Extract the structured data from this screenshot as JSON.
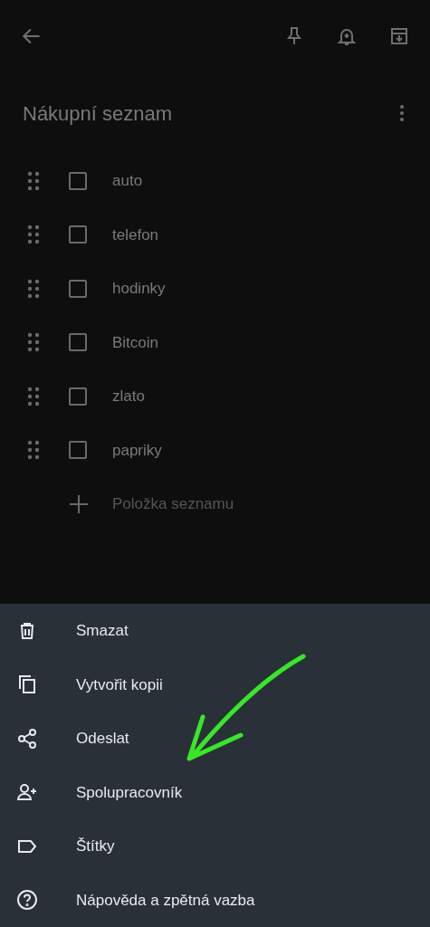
{
  "note": {
    "title": "Nákupní seznam",
    "items": [
      {
        "text": "auto",
        "checked": false
      },
      {
        "text": "telefon",
        "checked": false
      },
      {
        "text": "hodinky",
        "checked": false
      },
      {
        "text": "Bitcoin",
        "checked": false
      },
      {
        "text": "zlato",
        "checked": false
      },
      {
        "text": "papriky",
        "checked": false
      }
    ],
    "add_item": {
      "placeholder": "Položka seznamu"
    }
  },
  "menu": [
    {
      "kind": "delete",
      "label": "Smazat"
    },
    {
      "kind": "copy",
      "label": "Vytvořit kopii"
    },
    {
      "kind": "share",
      "label": "Odeslat"
    },
    {
      "kind": "collaborator",
      "label": "Spolupracovník"
    },
    {
      "kind": "labels",
      "label": "Štítky"
    },
    {
      "kind": "help",
      "label": "Nápověda a zpětná vazba"
    }
  ]
}
